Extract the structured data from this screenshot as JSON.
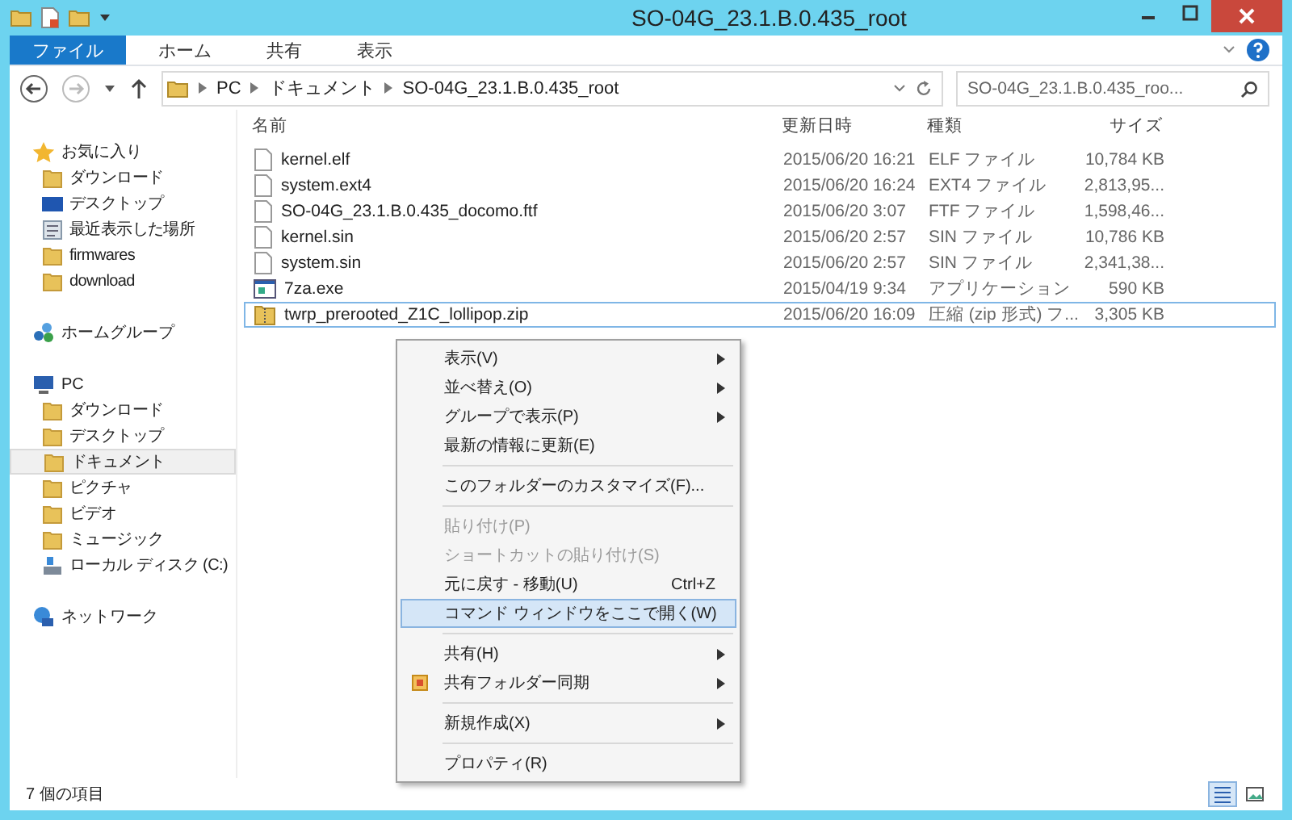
{
  "window": {
    "title": "SO-04G_23.1.B.0.435_root"
  },
  "ribbon_tabs": [
    {
      "label": "ファイル",
      "kind": "file",
      "selected": true
    },
    {
      "label": "ホーム",
      "kind": "tab",
      "selected": false
    },
    {
      "label": "共有",
      "kind": "tab",
      "selected": false
    },
    {
      "label": "表示",
      "kind": "tab",
      "selected": false
    }
  ],
  "address": {
    "crumbs": [
      "PC",
      "ドキュメント",
      "SO-04G_23.1.B.0.435_root"
    ]
  },
  "search": {
    "placeholder": "SO-04G_23.1.B.0.435_roo..."
  },
  "sidebar": {
    "sections": [
      {
        "label": "お気に入り",
        "kind": "star",
        "selected": false,
        "children": [
          {
            "label": "ダウンロード",
            "kind": "folder",
            "selected": false
          },
          {
            "label": "デスクトップ",
            "kind": "desktop",
            "selected": false
          },
          {
            "label": "最近表示した場所",
            "kind": "recent",
            "selected": false
          },
          {
            "label": "firmwares",
            "kind": "folder",
            "selected": false
          },
          {
            "label": "download",
            "kind": "folder",
            "selected": false
          }
        ]
      },
      {
        "label": "ホームグループ",
        "kind": "homegroup",
        "selected": false
      },
      {
        "label": "PC",
        "kind": "pc",
        "selected": false,
        "children": [
          {
            "label": "ダウンロード",
            "kind": "folder",
            "selected": false
          },
          {
            "label": "デスクトップ",
            "kind": "folder",
            "selected": false
          },
          {
            "label": "ドキュメント",
            "kind": "folder",
            "selected": true
          },
          {
            "label": "ピクチャ",
            "kind": "folder",
            "selected": false
          },
          {
            "label": "ビデオ",
            "kind": "folder",
            "selected": false
          },
          {
            "label": "ミュージック",
            "kind": "folder",
            "selected": false
          },
          {
            "label": "ローカル ディスク (C:)",
            "kind": "drive",
            "selected": false
          }
        ]
      },
      {
        "label": "ネットワーク",
        "kind": "network",
        "selected": false
      }
    ]
  },
  "table": {
    "columns": [
      "名前",
      "更新日時",
      "種類",
      "サイズ"
    ],
    "rows": [
      {
        "kind": "file",
        "selected": false,
        "cells": [
          "kernel.elf",
          "2015/06/20 16:21",
          "ELF ファイル",
          "10,784 KB"
        ]
      },
      {
        "kind": "file",
        "selected": false,
        "cells": [
          "system.ext4",
          "2015/06/20 16:24",
          "EXT4 ファイル",
          "2,813,95..."
        ]
      },
      {
        "kind": "file",
        "selected": false,
        "cells": [
          "SO-04G_23.1.B.0.435_docomo.ftf",
          "2015/06/20 3:07",
          "FTF ファイル",
          "1,598,46..."
        ]
      },
      {
        "kind": "file",
        "selected": false,
        "cells": [
          "kernel.sin",
          "2015/06/20 2:57",
          "SIN ファイル",
          "10,786 KB"
        ]
      },
      {
        "kind": "file",
        "selected": false,
        "cells": [
          "system.sin",
          "2015/06/20 2:57",
          "SIN ファイル",
          "2,341,38..."
        ]
      },
      {
        "kind": "exe",
        "selected": false,
        "cells": [
          "7za.exe",
          "2015/04/19 9:34",
          "アプリケーション",
          "590 KB"
        ]
      },
      {
        "kind": "zip",
        "selected": true,
        "cells": [
          "twrp_prerooted_Z1C_lollipop.zip",
          "2015/06/20 16:09",
          "圧縮 (zip 形式) フ...",
          "3,305 KB"
        ]
      }
    ]
  },
  "context_menu": [
    {
      "kind": "item",
      "label": "表示(V)",
      "submenu": true,
      "disabled": false,
      "selected": false
    },
    {
      "kind": "item",
      "label": "並べ替え(O)",
      "submenu": true,
      "disabled": false,
      "selected": false
    },
    {
      "kind": "item",
      "label": "グループで表示(P)",
      "submenu": true,
      "disabled": false,
      "selected": false
    },
    {
      "kind": "item",
      "label": "最新の情報に更新(E)",
      "submenu": false,
      "disabled": false,
      "selected": false
    },
    {
      "kind": "separator"
    },
    {
      "kind": "item",
      "label": "このフォルダーのカスタマイズ(F)...",
      "submenu": false,
      "disabled": false,
      "selected": false
    },
    {
      "kind": "separator"
    },
    {
      "kind": "item",
      "label": "貼り付け(P)",
      "submenu": false,
      "disabled": true,
      "selected": false
    },
    {
      "kind": "item",
      "label": "ショートカットの貼り付け(S)",
      "submenu": false,
      "disabled": true,
      "selected": false
    },
    {
      "kind": "item",
      "label": "元に戻す - 移動(U)",
      "shortcut": "Ctrl+Z",
      "submenu": false,
      "disabled": false,
      "selected": false
    },
    {
      "kind": "item",
      "label": "コマンド ウィンドウをここで開く(W)",
      "submenu": false,
      "disabled": false,
      "selected": true
    },
    {
      "kind": "separator"
    },
    {
      "kind": "item",
      "label": "共有(H)",
      "submenu": true,
      "disabled": false,
      "selected": false
    },
    {
      "kind": "icon_item",
      "label": "共有フォルダー同期",
      "submenu": true,
      "disabled": false,
      "selected": false
    },
    {
      "kind": "separator"
    },
    {
      "kind": "item",
      "label": "新規作成(X)",
      "submenu": true,
      "disabled": false,
      "selected": false
    },
    {
      "kind": "separator"
    },
    {
      "kind": "item",
      "label": "プロパティ(R)",
      "submenu": false,
      "disabled": false,
      "selected": false
    }
  ],
  "status_bar": {
    "count": "7 個の項目"
  }
}
